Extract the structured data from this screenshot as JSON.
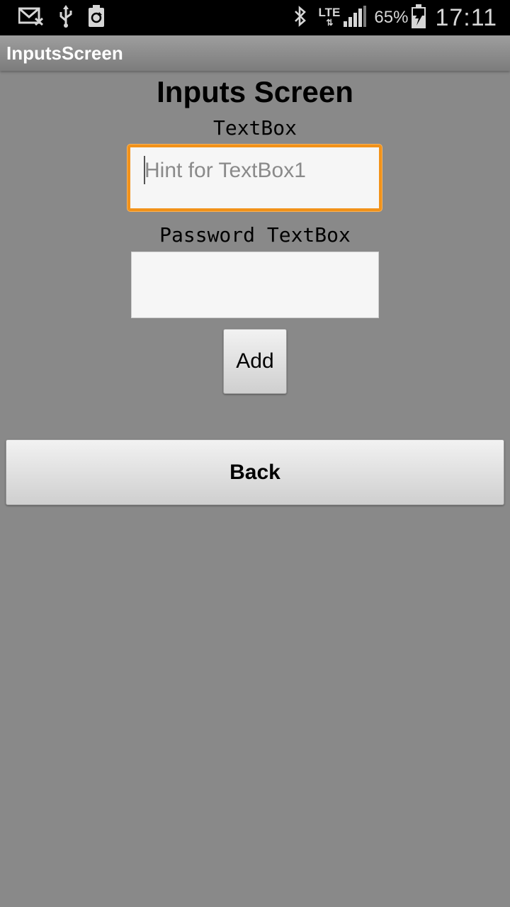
{
  "status_bar": {
    "icons_left": [
      "mail-error-icon",
      "usb-icon",
      "recycle-icon"
    ],
    "icons_right": [
      "bluetooth-icon",
      "signal-icon",
      "battery-charging-icon"
    ],
    "network": "LTE",
    "battery_percent": "65%",
    "time": "17:11"
  },
  "title_bar": {
    "title": "InputsScreen"
  },
  "main": {
    "heading": "Inputs Screen",
    "textbox_label": "TextBox",
    "textbox_placeholder": "Hint for TextBox1",
    "textbox_value": "",
    "password_label": "Password TextBox",
    "password_value": "",
    "add_button": "Add",
    "back_button": "Back"
  },
  "colors": {
    "background": "#898989",
    "focus_border": "#f29219",
    "status_bar": "#000000"
  }
}
